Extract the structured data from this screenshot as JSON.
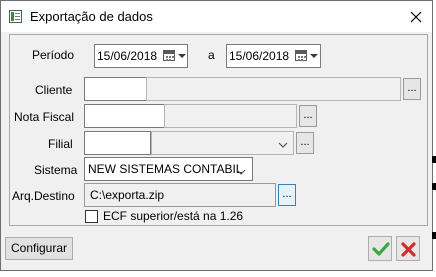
{
  "window": {
    "title": "Exportação de dados"
  },
  "form": {
    "periodo_label": "Período",
    "date_from": "15/06/2018",
    "date_separator": "a",
    "date_to": "15/06/2018",
    "cliente_label": "Cliente",
    "cliente_code": "",
    "cliente_name": "",
    "nota_fiscal_label": "Nota Fiscal",
    "nota_fiscal_code": "",
    "nota_fiscal_name": "",
    "filial_label": "Filial",
    "filial_code": "",
    "filial_name": "",
    "sistema_label": "Sistema",
    "sistema_value": "NEW SISTEMAS CONTABIL",
    "arq_destino_label": "Arq.Destino",
    "arq_destino_value": "C:\\exporta.zip",
    "ellipsis": "...",
    "ecf_label": "ECF superior/está na 1.26",
    "ecf_checked": false
  },
  "footer": {
    "configurar_label": "Configurar"
  },
  "icons": {
    "app": "app-window-icon",
    "close": "close-icon",
    "calendar": "calendar-icon",
    "confirm": "checkmark-icon",
    "cancel": "x-icon"
  },
  "colors": {
    "confirm_green": "#3fa73f",
    "cancel_red": "#d42a2a",
    "active_border": "#3c7fb1"
  }
}
